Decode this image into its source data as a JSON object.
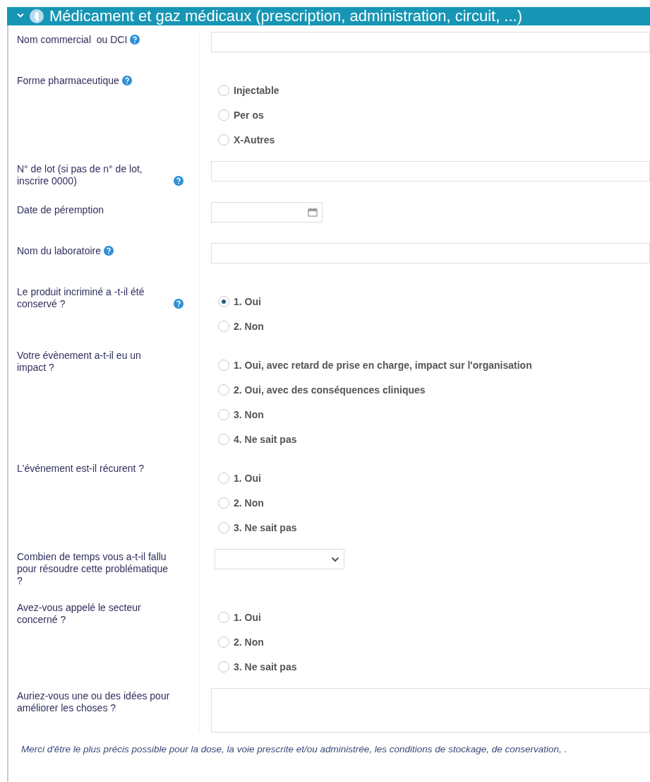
{
  "section": {
    "title": "Médicament et gaz médicaux (prescription, administration, circuit, ...)",
    "expanded": true
  },
  "rows": [
    {
      "kind": "text",
      "label": "Nom commercial  ou DCI",
      "help": true
    },
    {
      "kind": "radio",
      "label": "Forme pharmaceutique",
      "help": true,
      "options": [
        {
          "label": "Injectable",
          "selected": false
        },
        {
          "label": "Per os",
          "selected": false
        },
        {
          "label": "X-Autres",
          "selected": false
        }
      ]
    },
    {
      "kind": "text",
      "label": "N° de lot (si pas de n° de lot, inscrire 0000)",
      "help": true
    },
    {
      "kind": "date",
      "label": "Date de péremption",
      "help": false
    },
    {
      "kind": "text",
      "label": "Nom du laboratoire",
      "help": true
    },
    {
      "kind": "radio",
      "label": "Le produit incriminé a -t-il été conservé ?",
      "help": true,
      "options": [
        {
          "label": "1. Oui",
          "selected": true
        },
        {
          "label": "2. Non",
          "selected": false
        }
      ]
    },
    {
      "kind": "radio",
      "label": "Votre évènement a-t-il eu un impact ?",
      "help": false,
      "options": [
        {
          "label": "1. Oui, avec retard de prise en charge, impact sur l'organisation",
          "selected": false
        },
        {
          "label": "2. Oui, avec des conséquences cliniques",
          "selected": false
        },
        {
          "label": "3. Non",
          "selected": false
        },
        {
          "label": "4. Ne sait pas",
          "selected": false
        }
      ]
    },
    {
      "kind": "radio",
      "label": "L'événement est-il récurent ?",
      "help": false,
      "options": [
        {
          "label": "1. Oui",
          "selected": false
        },
        {
          "label": "2. Non",
          "selected": false
        },
        {
          "label": "3. Ne sait pas",
          "selected": false
        }
      ]
    },
    {
      "kind": "select",
      "label": "Combien de temps vous a-t-il fallu pour résoudre cette problématique ?",
      "help": false
    },
    {
      "kind": "radio",
      "label": "Avez-vous appelé le secteur concerné ?",
      "help": false,
      "options": [
        {
          "label": "1. Oui",
          "selected": false
        },
        {
          "label": "2. Non",
          "selected": false
        },
        {
          "label": "3. Ne sait pas",
          "selected": false
        }
      ]
    },
    {
      "kind": "textarea",
      "label": "Auriez-vous une ou des idées pour améliorer les choses ?",
      "help": false
    }
  ],
  "note": "Merci d'être le plus précis possible pour la dose, la voie prescrite et/ou administrée, les conditions de stockage, de conservation, ."
}
